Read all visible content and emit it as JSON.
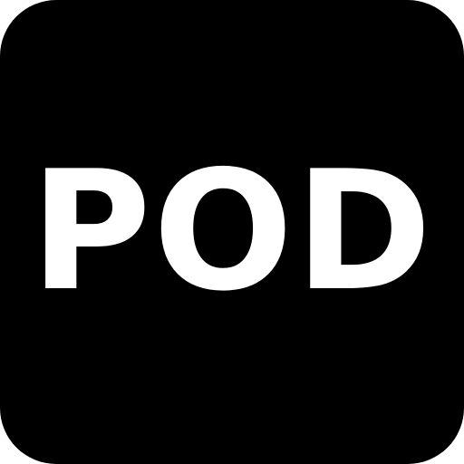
{
  "icon": {
    "label": "POD",
    "background_color": "#000000",
    "text_color": "#ffffff"
  }
}
